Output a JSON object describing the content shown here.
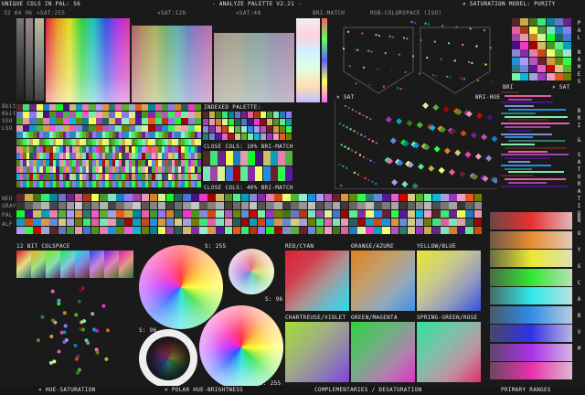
{
  "header": {
    "unique_cols": "UNIQUE COLS IN PAL: 56",
    "title": "- ANALYZE PALETTE V2.21 -",
    "sat_model": "× SATURATION MODEL: PURITY"
  },
  "sublabels": {
    "sat255": "×SAT:255",
    "sat128": "×SAT:128",
    "sat48": "×SAT:48",
    "bri_match": "BRI-MATCH",
    "rgb_space": "RGB-COLORSPACE (ISO)",
    "small_scale": "32 64 96"
  },
  "left_labels": {
    "bits8": "8bit",
    "bits6": "6bit",
    "sso": "SSO",
    "lso": "LSO",
    "neu": "NEU",
    "gray": "GRAY",
    "pal": "PAL",
    "alf": "ALF"
  },
  "indexed": {
    "title": "INDEXED PALETTE:",
    "close10": "CLOSE COLS: 10% BRI-MATCH",
    "close40": "CLOSE COLS: 40% BRI-MATCH"
  },
  "scatter": {
    "sat": "× SAT",
    "bri_hue": "BRI-HUE",
    "bri": "BRI",
    "sat2": "× SAT"
  },
  "side_vertical": {
    "pal_names": "PAL NAMES",
    "bri_sat": "BRI & SATURATION",
    "hues": "ROYGCABVM"
  },
  "colspace": {
    "label": "12 BIT COLSPACE"
  },
  "polar": {
    "s255": "S: 255",
    "s96a": "S: 96",
    "s96b": "S: 96",
    "s255b": "S: 255"
  },
  "complements": {
    "red_cyan": "RED/CYAN",
    "orange_azure": "ORANGE/AZURE",
    "yellow_blue": "YELLOW/BLUE",
    "chart_violet": "CHARTREUSE/VIOLET",
    "green_magenta": "GREEN/MAGENTA",
    "spring_rose": "SPRING-GREEN/ROSE"
  },
  "footer": {
    "hue_sat": "× HUE-SATURATION",
    "polar": "× POLAR HUE-BRIGHTNESS",
    "complementaries": "COMPLEMENTARIES / DESATURATION",
    "primary": "PRIMARY RANGES"
  },
  "colors": {
    "bg": "#1a1a1a",
    "panel": "#2a2a2a",
    "text": "#e6e6e6"
  }
}
